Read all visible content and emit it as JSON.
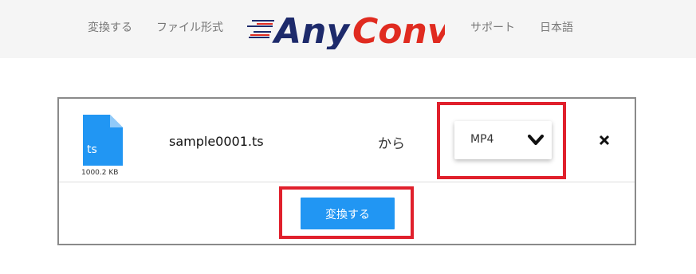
{
  "header": {
    "nav": {
      "convert": "変換する",
      "formats": "ファイル形式",
      "support": "サポート",
      "language": "日本語"
    },
    "logo": {
      "text_any": "Any",
      "text_conv": "Conv",
      "colors": {
        "navy": "#1d2a6b",
        "red": "#e02b20"
      }
    }
  },
  "file": {
    "icon": "file-icon",
    "ext_badge": "ts",
    "size": "1000.2 KB",
    "name": "sample0001.ts"
  },
  "conversion": {
    "from_label": "から",
    "format_selected": "MP4",
    "remove_icon": "close-icon",
    "convert_button": "変換する"
  },
  "colors": {
    "accent": "#2196f3",
    "highlight": "#e0202c"
  }
}
